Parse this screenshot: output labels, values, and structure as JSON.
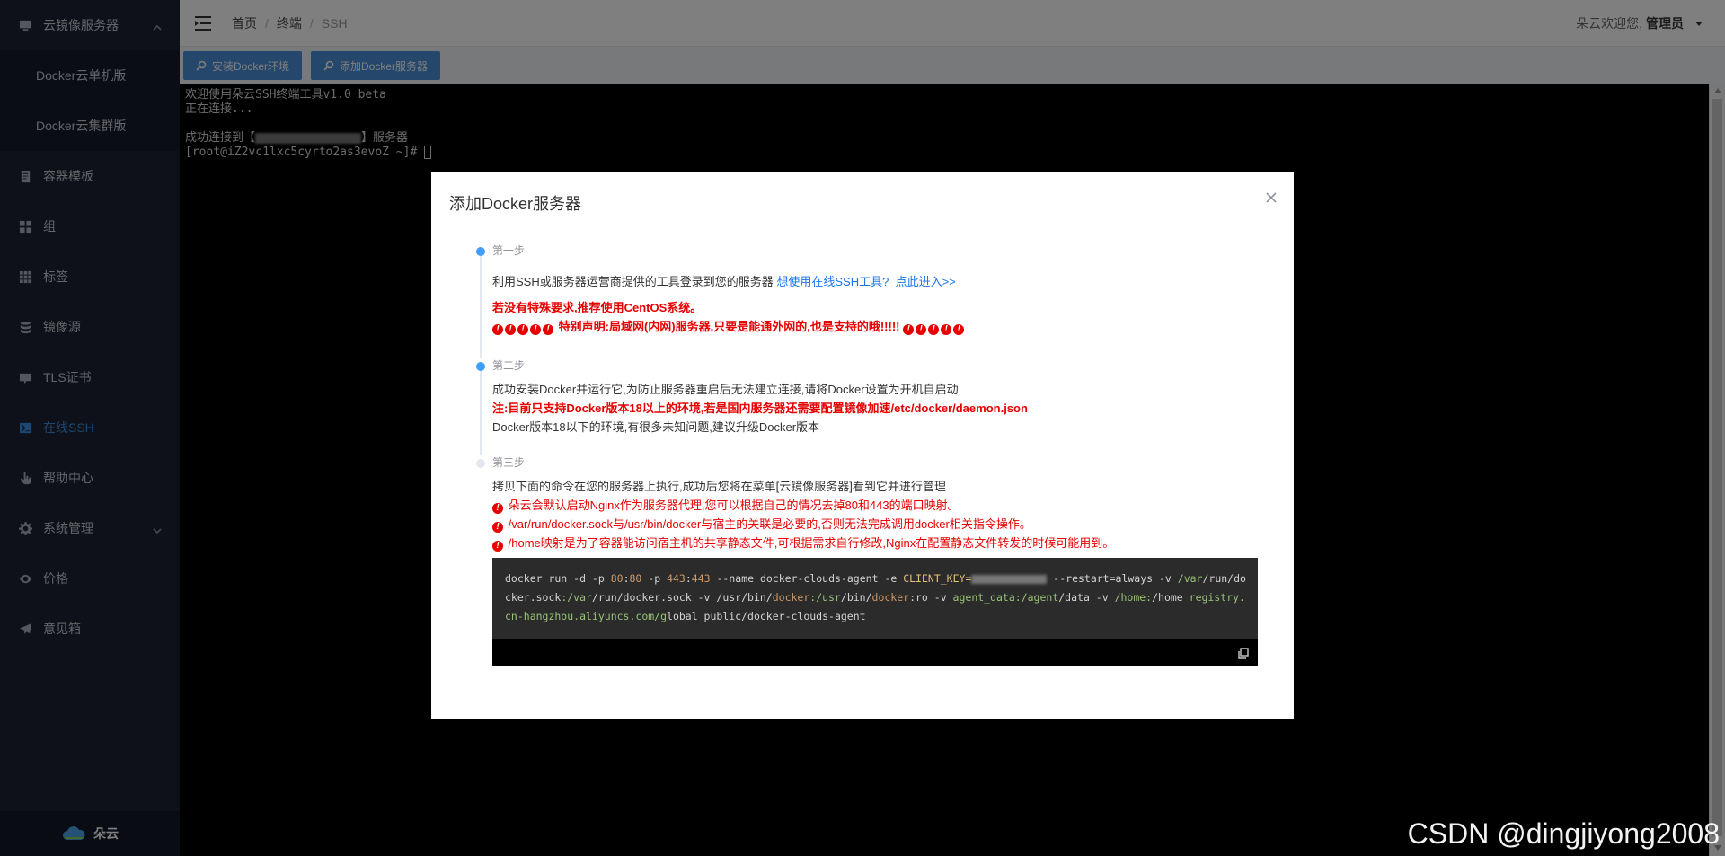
{
  "sidebar": {
    "items": [
      {
        "label": "云镜像服务器",
        "icon": "monitor-icon",
        "expanded": true
      },
      {
        "label": "Docker云单机版",
        "sub": true
      },
      {
        "label": "Docker云集群版",
        "sub": true
      },
      {
        "label": "容器模板",
        "icon": "document-icon"
      },
      {
        "label": "组",
        "icon": "grid-icon"
      },
      {
        "label": "标签",
        "icon": "apps-icon"
      },
      {
        "label": "镜像源",
        "icon": "database-icon"
      },
      {
        "label": "TLS证书",
        "icon": "certificate-icon"
      },
      {
        "label": "在线SSH",
        "icon": "terminal-icon",
        "active": true
      },
      {
        "label": "帮助中心",
        "icon": "hand-icon"
      },
      {
        "label": "系统管理",
        "icon": "gear-icon"
      },
      {
        "label": "价格",
        "icon": "eye-icon"
      },
      {
        "label": "意见箱",
        "icon": "send-icon"
      }
    ],
    "brand": "朵云"
  },
  "header": {
    "breadcrumb": [
      "首页",
      "终端",
      "SSH"
    ],
    "welcome": "朵云欢迎您,",
    "user": "管理员"
  },
  "toolbar": {
    "install_label": "安装Docker环境",
    "add_label": "添加Docker服务器"
  },
  "terminal": {
    "line1": "欢迎使用朵云SSH终端工具v1.0 beta",
    "line2": "正在连接...",
    "line4_prefix": "成功连接到【",
    "line4_suffix": "】服务器",
    "line5": "[root@iZ2vc1lxc5cyrto2as3evoZ ~]# "
  },
  "modal": {
    "title": "添加Docker服务器",
    "step1": {
      "label": "第一步",
      "text": "利用SSH或服务器运营商提供的工具登录到您的服务器",
      "link1": "想使用在线SSH工具?",
      "link2": "点此进入>>",
      "red1": "若没有特殊要求,推荐使用CentOS系统。",
      "red2": "特别声明:局域网(内网)服务器,只要是能通外网的,也是支持的哦!!!!!"
    },
    "step2": {
      "label": "第二步",
      "text1": "成功安装Docker并运行它,为防止服务器重启后无法建立连接,请将Docker设置为开机自启动",
      "red": "注:目前只支持Docker版本18以上的环境,若是国内服务器还需要配置镜像加速/etc/docker/daemon.json",
      "text2": "Docker版本18以下的环境,有很多未知问题,建议升级Docker版本"
    },
    "step3": {
      "label": "第三步",
      "text": "拷贝下面的命令在您的服务器上执行,成功后您将在菜单[云镜像服务器]看到它并进行管理",
      "warn1": "朵云会默认启动Nginx作为服务器代理,您可以根据自己的情况去掉80和443的端口映射。",
      "warn2": "/var/run/docker.sock与/usr/bin/docker与宿主的关联是必要的,否则无法完成调用docker相关指令操作。",
      "warn3": "/home映射是为了容器能访问宿主机的共享静态文件,可根据需求自行修改,Nginx在配置静态文件转发的时候可能用到。"
    },
    "code": {
      "c1": "docker run -d -p ",
      "p80a": "80",
      "colon1": ":",
      "p80b": "80",
      "c2": " -p ",
      "p443a": "443",
      "colon2": ":",
      "p443b": "443",
      "c3": " --name docker-clouds-agent -e ",
      "key": "CLIENT_KEY=",
      "c4": "  --restart=always -v ",
      "var1": "/var",
      "c5": "/run/docker.sock",
      "var2": ":/var",
      "c6": "/run/docker.sock -v /usr/bin/",
      "dk1": "docker",
      "usr2": ":/usr",
      "c7": "/bin/",
      "dk2": "docker",
      "c8": ":ro -v ",
      "agent": "agent_data:/agent",
      "c9": "/data -v ",
      "home1": "/home:",
      "c10": "/home ",
      "reg": "registry.cn-hangzhou.aliyuncs.com/g",
      "c11": "lobal_public/docker-clouds-agent"
    }
  },
  "watermark": "CSDN @dingjiyong2008"
}
